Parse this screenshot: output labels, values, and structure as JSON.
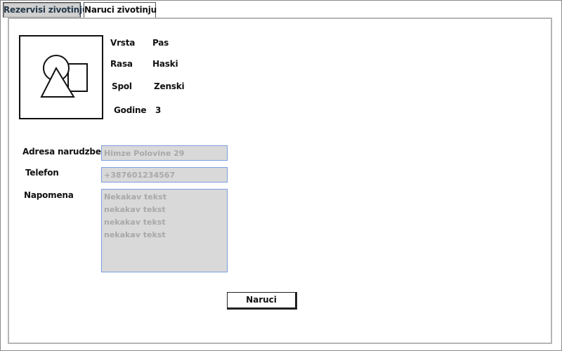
{
  "tabs": [
    {
      "label": "Rezervisi zivotinju",
      "active": true
    },
    {
      "label": "Naruci zivotinju",
      "active": false
    }
  ],
  "animal": {
    "photo_icon": "shapes-placeholder-icon",
    "details": [
      {
        "label": "Vrsta",
        "value": "Pas"
      },
      {
        "label": "Rasa",
        "value": "Haski"
      },
      {
        "label": "Spol",
        "value": "Zenski"
      },
      {
        "label": "Godine",
        "value": "3"
      }
    ]
  },
  "form": {
    "address": {
      "label": "Adresa narudzbe",
      "placeholder": "Himze Polovine 29"
    },
    "phone": {
      "label": "Telefon",
      "placeholder": "+387601234567"
    },
    "note": {
      "label": "Napomena",
      "placeholder": "Nekakav tekst\nnekakav tekst\nnekakav tekst\nnekakav tekst"
    }
  },
  "submit_label": "Naruci",
  "colors": {
    "active_tab_bg": "#d0d0d0",
    "active_tab_text": "#24384a",
    "field_bg": "#d9d9d9",
    "field_border": "#7b9ee0",
    "placeholder_text": "#a8a8a8"
  }
}
